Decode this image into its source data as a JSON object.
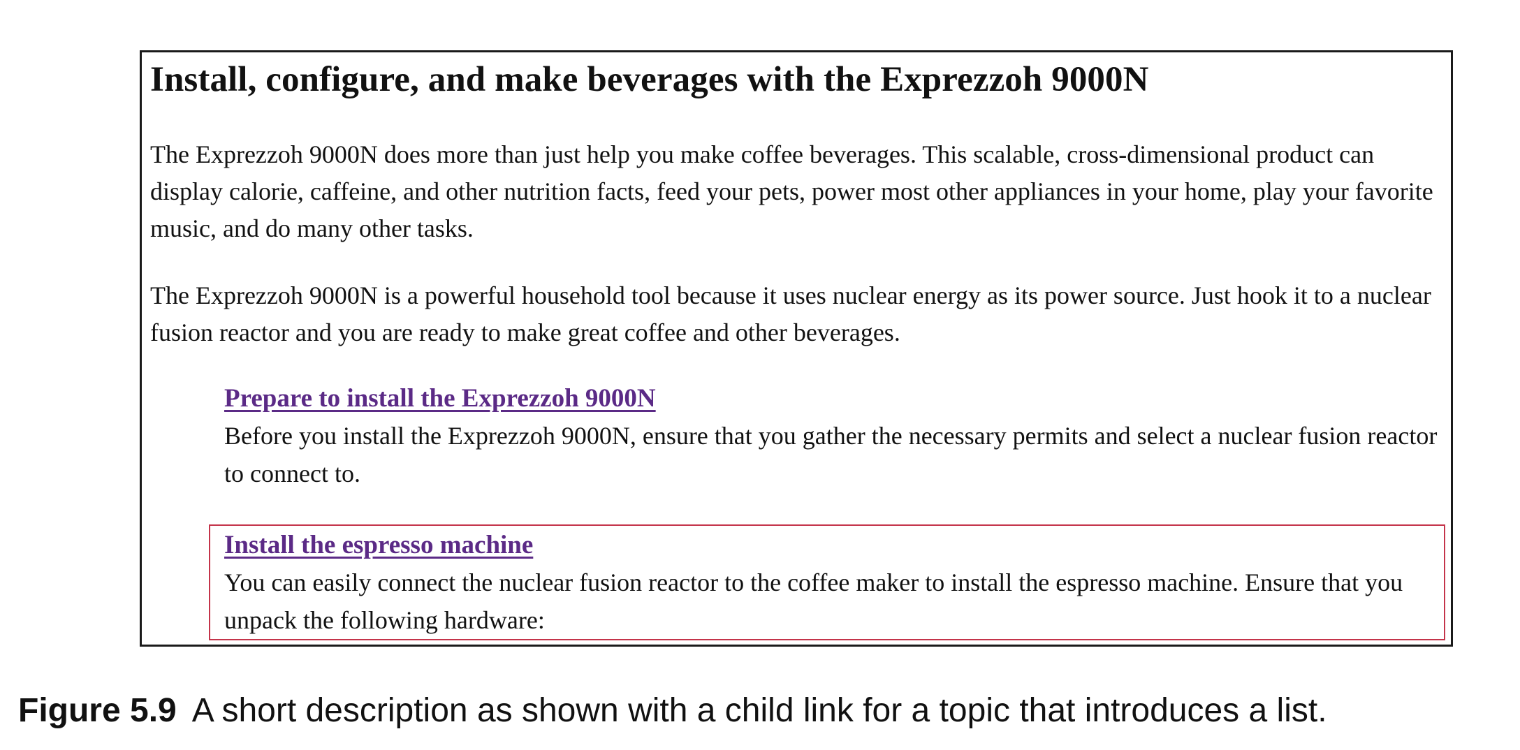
{
  "topic": {
    "title": "Install, configure, and make beverages with the Exprezzoh 9000N",
    "paragraphs": [
      "The Exprezzoh 9000N does more than just help you make coffee beverages. This scalable, cross-dimensional product can display calorie, caffeine, and other nutrition facts, feed your pets, power most other appliances in your home, play your favorite music, and do many other tasks.",
      "The Exprezzoh 9000N is a powerful household tool because it uses nuclear energy as its power source. Just hook it to a nuclear fusion reactor and you are ready to make great coffee and other beverages."
    ],
    "child_links": [
      {
        "label": "Prepare to install the Exprezzoh 9000N",
        "description": "Before you install the Exprezzoh 9000N, ensure that you gather the necessary permits and select a nuclear fusion reactor to connect to."
      },
      {
        "label": "Install the espresso machine",
        "description": "You can easily connect the nuclear fusion reactor to the coffee maker to install the espresso machine. Ensure that you unpack the following hardware:"
      }
    ]
  },
  "caption": {
    "label": "Figure 5.9",
    "text": "A short description as shown with a child link for a topic that introduces a list."
  },
  "colors": {
    "link": "#5b2a86",
    "highlight_border": "#c4344a",
    "frame_border": "#1a1a1a"
  }
}
